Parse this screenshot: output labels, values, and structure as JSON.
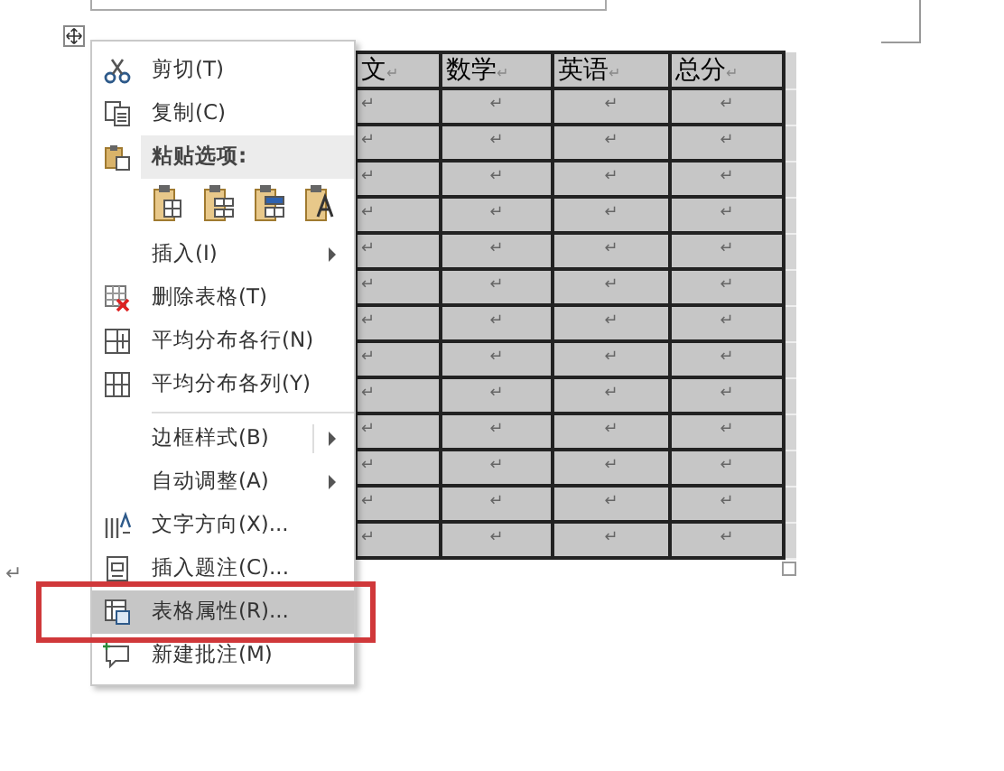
{
  "table": {
    "columns": [
      {
        "label": "文",
        "mark": "↵"
      },
      {
        "label": "数学",
        "mark": "↵"
      },
      {
        "label": "英语",
        "mark": "↵"
      },
      {
        "label": "总分",
        "mark": "↵"
      }
    ],
    "rows": [
      [
        "↵",
        "↵",
        "↵",
        "↵"
      ],
      [
        "↵",
        "↵",
        "↵",
        "↵"
      ],
      [
        "↵",
        "↵",
        "↵",
        "↵"
      ],
      [
        "↵",
        "↵",
        "↵",
        "↵"
      ],
      [
        "↵",
        "↵",
        "↵",
        "↵"
      ],
      [
        "↵",
        "↵",
        "↵",
        "↵"
      ],
      [
        "↵",
        "↵",
        "↵",
        "↵"
      ],
      [
        "↵",
        "↵",
        "↵",
        "↵"
      ],
      [
        "↵",
        "↵",
        "↵",
        "↵"
      ],
      [
        "↵",
        "↵",
        "↵",
        "↵"
      ],
      [
        "↵",
        "↵",
        "↵",
        "↵"
      ],
      [
        "↵",
        "↵",
        "↵",
        "↵"
      ],
      [
        "↵",
        "↵",
        "↵",
        "↵"
      ]
    ]
  },
  "paragraph_mark": "↵",
  "context_menu": {
    "items": [
      {
        "kind": "item",
        "label": "剪切(T)",
        "submenu": false,
        "selected": false
      },
      {
        "kind": "item",
        "label": "复制(C)",
        "submenu": false,
        "selected": false
      },
      {
        "kind": "header",
        "label": "粘贴选项:"
      },
      {
        "kind": "paste_options"
      },
      {
        "kind": "item",
        "label": "插入(I)",
        "submenu": true,
        "selected": false
      },
      {
        "kind": "item",
        "label": "删除表格(T)",
        "submenu": false,
        "selected": false
      },
      {
        "kind": "item",
        "label": "平均分布各行(N)",
        "submenu": false,
        "selected": false
      },
      {
        "kind": "item",
        "label": "平均分布各列(Y)",
        "submenu": false,
        "selected": false
      },
      {
        "kind": "separator"
      },
      {
        "kind": "item",
        "label": "边框样式(B)",
        "submenu": true,
        "split": true,
        "selected": false
      },
      {
        "kind": "item",
        "label": "自动调整(A)",
        "submenu": true,
        "selected": false
      },
      {
        "kind": "item",
        "label": "文字方向(X)...",
        "submenu": false,
        "selected": false
      },
      {
        "kind": "item",
        "label": "插入题注(C)...",
        "submenu": false,
        "selected": false
      },
      {
        "kind": "item",
        "label": "表格属性(R)...",
        "submenu": false,
        "selected": true
      },
      {
        "kind": "item",
        "label": "新建批注(M)",
        "submenu": false,
        "selected": false
      }
    ]
  }
}
